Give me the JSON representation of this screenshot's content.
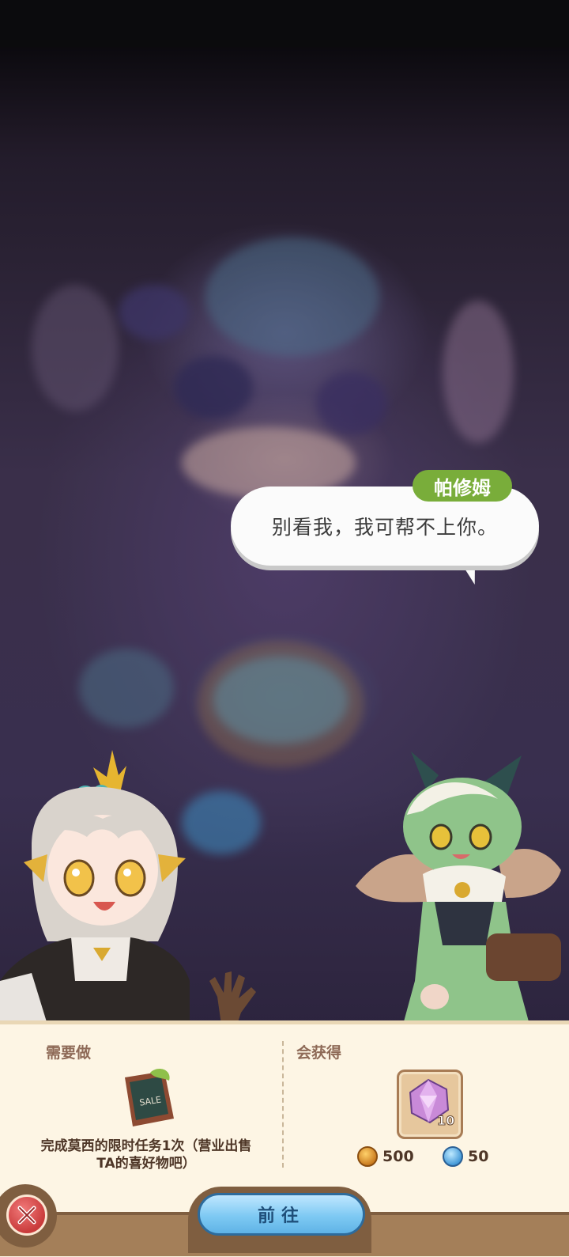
{
  "dialog": {
    "speaker": "帕修姆",
    "line": "别看我，我可帮不上你。"
  },
  "task_panel": {
    "todo_title": "需要做",
    "todo_icon": "sale-board-icon",
    "todo_desc": "完成莫西的限时任务1次（营业出售TA的喜好物吧）",
    "reward_title": "会获得",
    "reward_item": {
      "icon": "pink-crystal-icon",
      "count": "10"
    },
    "resources": [
      {
        "icon": "gold-coin-icon",
        "value": "500"
      },
      {
        "icon": "blue-drop-icon",
        "value": "50"
      }
    ]
  },
  "buttons": {
    "go_label": "前往",
    "close_icon": "close-icon"
  }
}
